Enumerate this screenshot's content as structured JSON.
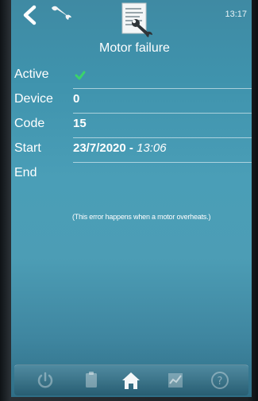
{
  "header": {
    "time": "13:17",
    "title": "Motor failure"
  },
  "fields": [
    {
      "label": "Active",
      "value": "",
      "status": "checked"
    },
    {
      "label": "Device",
      "value": "0"
    },
    {
      "label": "Code",
      "value": "15"
    },
    {
      "label": "Start",
      "value": "23/7/2020 - ",
      "time": "13:06"
    },
    {
      "label": "End",
      "value": ""
    }
  ],
  "description": "(This error happens when a motor overheats.)",
  "icons": {
    "back": "back-chevron-icon",
    "service": "wrench-icon",
    "report": "document-wrench-icon",
    "nav": [
      "power-icon",
      "clipboard-icon",
      "home-icon",
      "chart-icon",
      "help-icon"
    ]
  },
  "colors": {
    "check": "#3bd36a",
    "screen_top": "#3f8aa3",
    "screen_mid": "#4a9eb7"
  }
}
